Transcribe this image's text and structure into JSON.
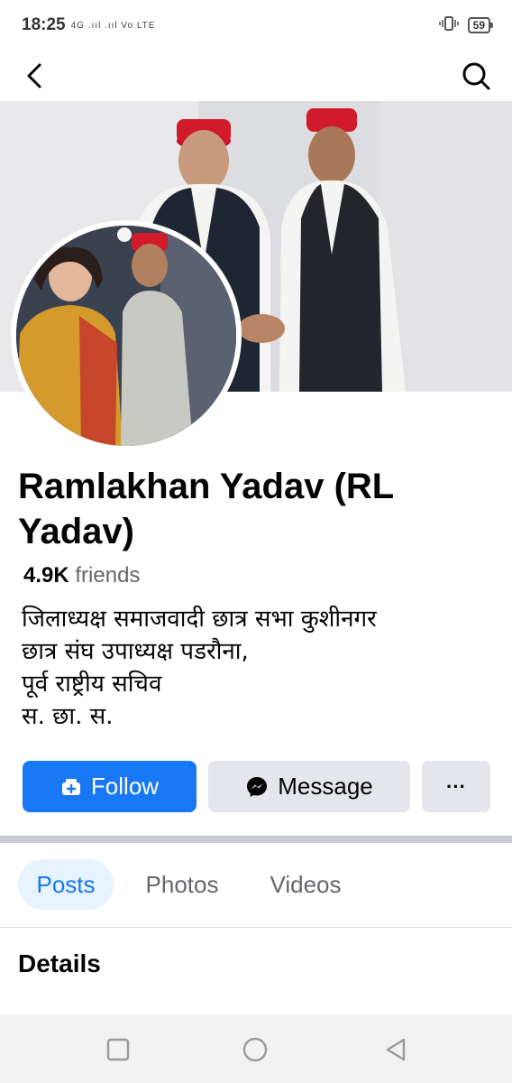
{
  "status_bar": {
    "time": "18:25",
    "network": "4G .ııl .ııl Vo LTE",
    "battery": "59"
  },
  "header": {
    "back_icon": "back-arrow-icon",
    "search_icon": "search-icon"
  },
  "profile": {
    "name": "Ramlakhan Yadav (RL Yadav)",
    "friends_count": "4.9K",
    "friends_label": "friends",
    "bio": "जिलाध्यक्ष समाजवादी छात्र सभा कुशीनगर\nछात्र संघ उपाध्यक्ष पडरौना,\nपूर्व राष्ट्रीय सचिव\n स. छा. स."
  },
  "actions": {
    "follow": "Follow",
    "message": "Message",
    "more": "···"
  },
  "tabs": {
    "posts": "Posts",
    "photos": "Photos",
    "videos": "Videos"
  },
  "section": {
    "details": "Details"
  },
  "colors": {
    "accent": "#1877f2",
    "secondary_button": "#e4e6eb",
    "muted_text": "#65676b"
  }
}
